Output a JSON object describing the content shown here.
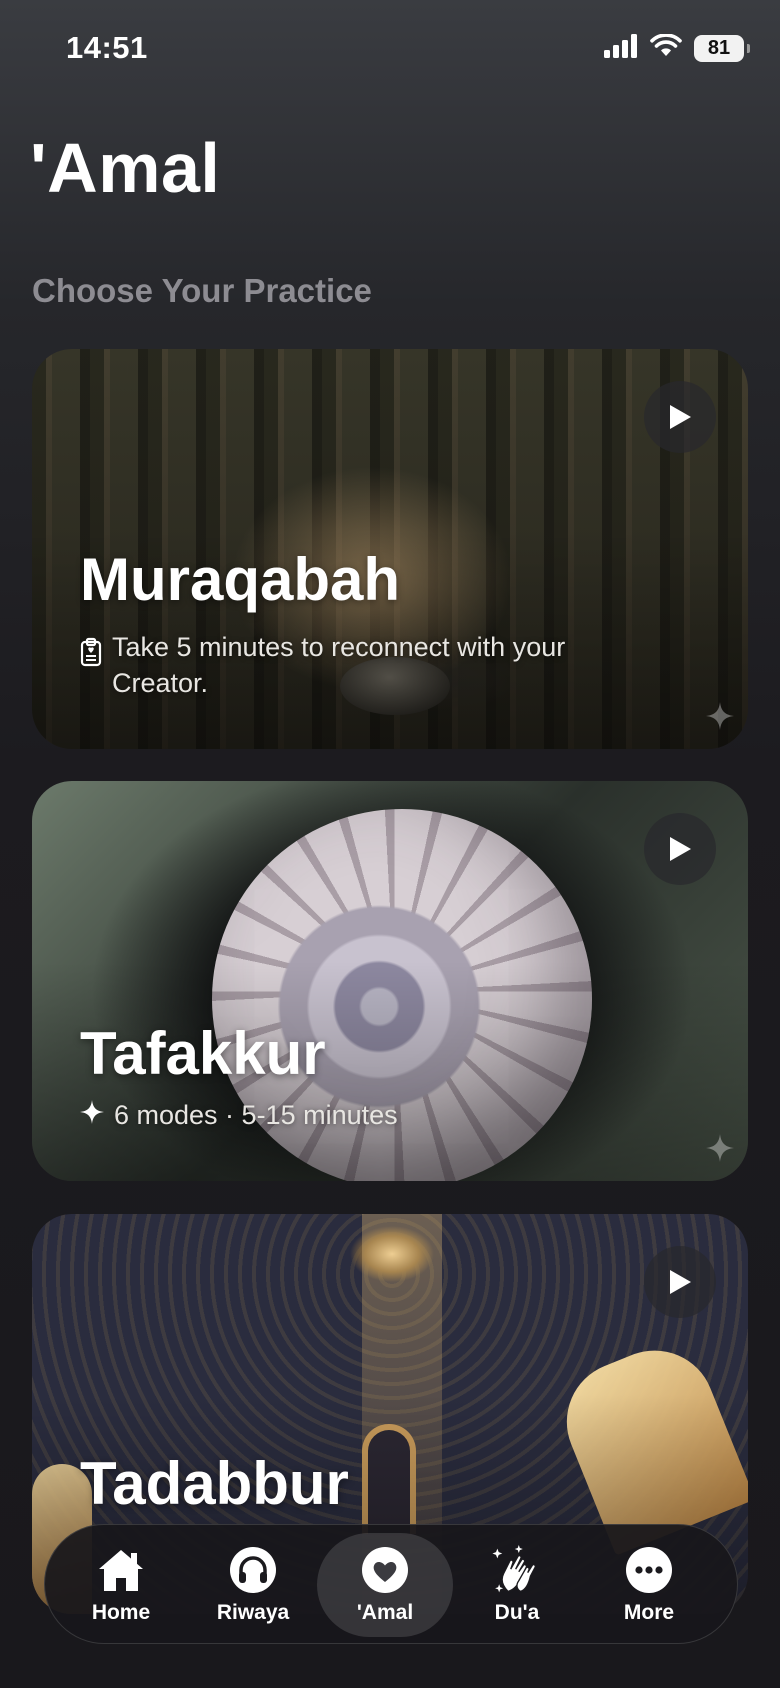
{
  "status_bar": {
    "time": "14:51",
    "battery": "81"
  },
  "page": {
    "title": "'Amal",
    "section_heading": "Choose Your Practice"
  },
  "cards": [
    {
      "title": "Muraqabah",
      "subtitle": "Take 5 minutes to reconnect with your Creator.",
      "subtitle_icon": "clipboard-icon",
      "image": "misty-forest"
    },
    {
      "title": "Tafakkur",
      "subtitle": "6 modes · 5-15 minutes",
      "subtitle_icon": "sparkle-icon",
      "image": "nautilus-shell"
    },
    {
      "title": "Tadabbur",
      "image": "spiral-staircase"
    }
  ],
  "tab_bar": {
    "items": [
      {
        "label": "Home",
        "icon": "home-icon",
        "active": false
      },
      {
        "label": "Riwaya",
        "icon": "headphones-icon",
        "active": false
      },
      {
        "label": "'Amal",
        "icon": "heart-icon",
        "active": true
      },
      {
        "label": "Du'a",
        "icon": "clapping-hands-icon",
        "active": false
      },
      {
        "label": "More",
        "icon": "more-icon",
        "active": false
      }
    ]
  }
}
